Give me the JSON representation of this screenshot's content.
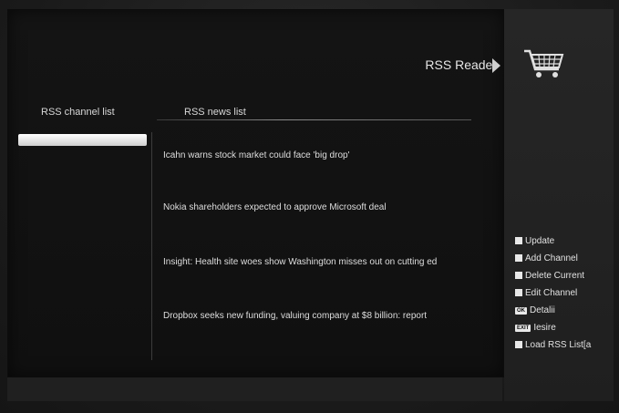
{
  "header": {
    "title": "RSS Reader"
  },
  "columns": {
    "channel_header": "RSS channel list",
    "news_header": "RSS news list"
  },
  "channels": [
    {
      "label": "",
      "selected": true
    }
  ],
  "news": [
    "Icahn warns stock market could face 'big drop'",
    "Nokia shareholders expected to approve Microsoft deal",
    "Insight: Health site woes show Washington misses out on cutting ed",
    "Dropbox seeks new funding, valuing company at $8 billion: report"
  ],
  "legend": {
    "update": "Update",
    "add_channel": "Add Channel",
    "delete_current": "Delete Current",
    "edit_channel": "Edit Channel",
    "ok_key": "OK",
    "detail": "Detalii",
    "exit_key": "EXIT",
    "exit": "Iesire",
    "load_list": "Load RSS List[a"
  },
  "icons": [
    "cart-icon",
    "arrow-right-icon"
  ],
  "colors": {
    "background": "#1b1b1b",
    "panel": "#111111",
    "text": "#dcdcdc",
    "highlight": "#ffffff"
  }
}
